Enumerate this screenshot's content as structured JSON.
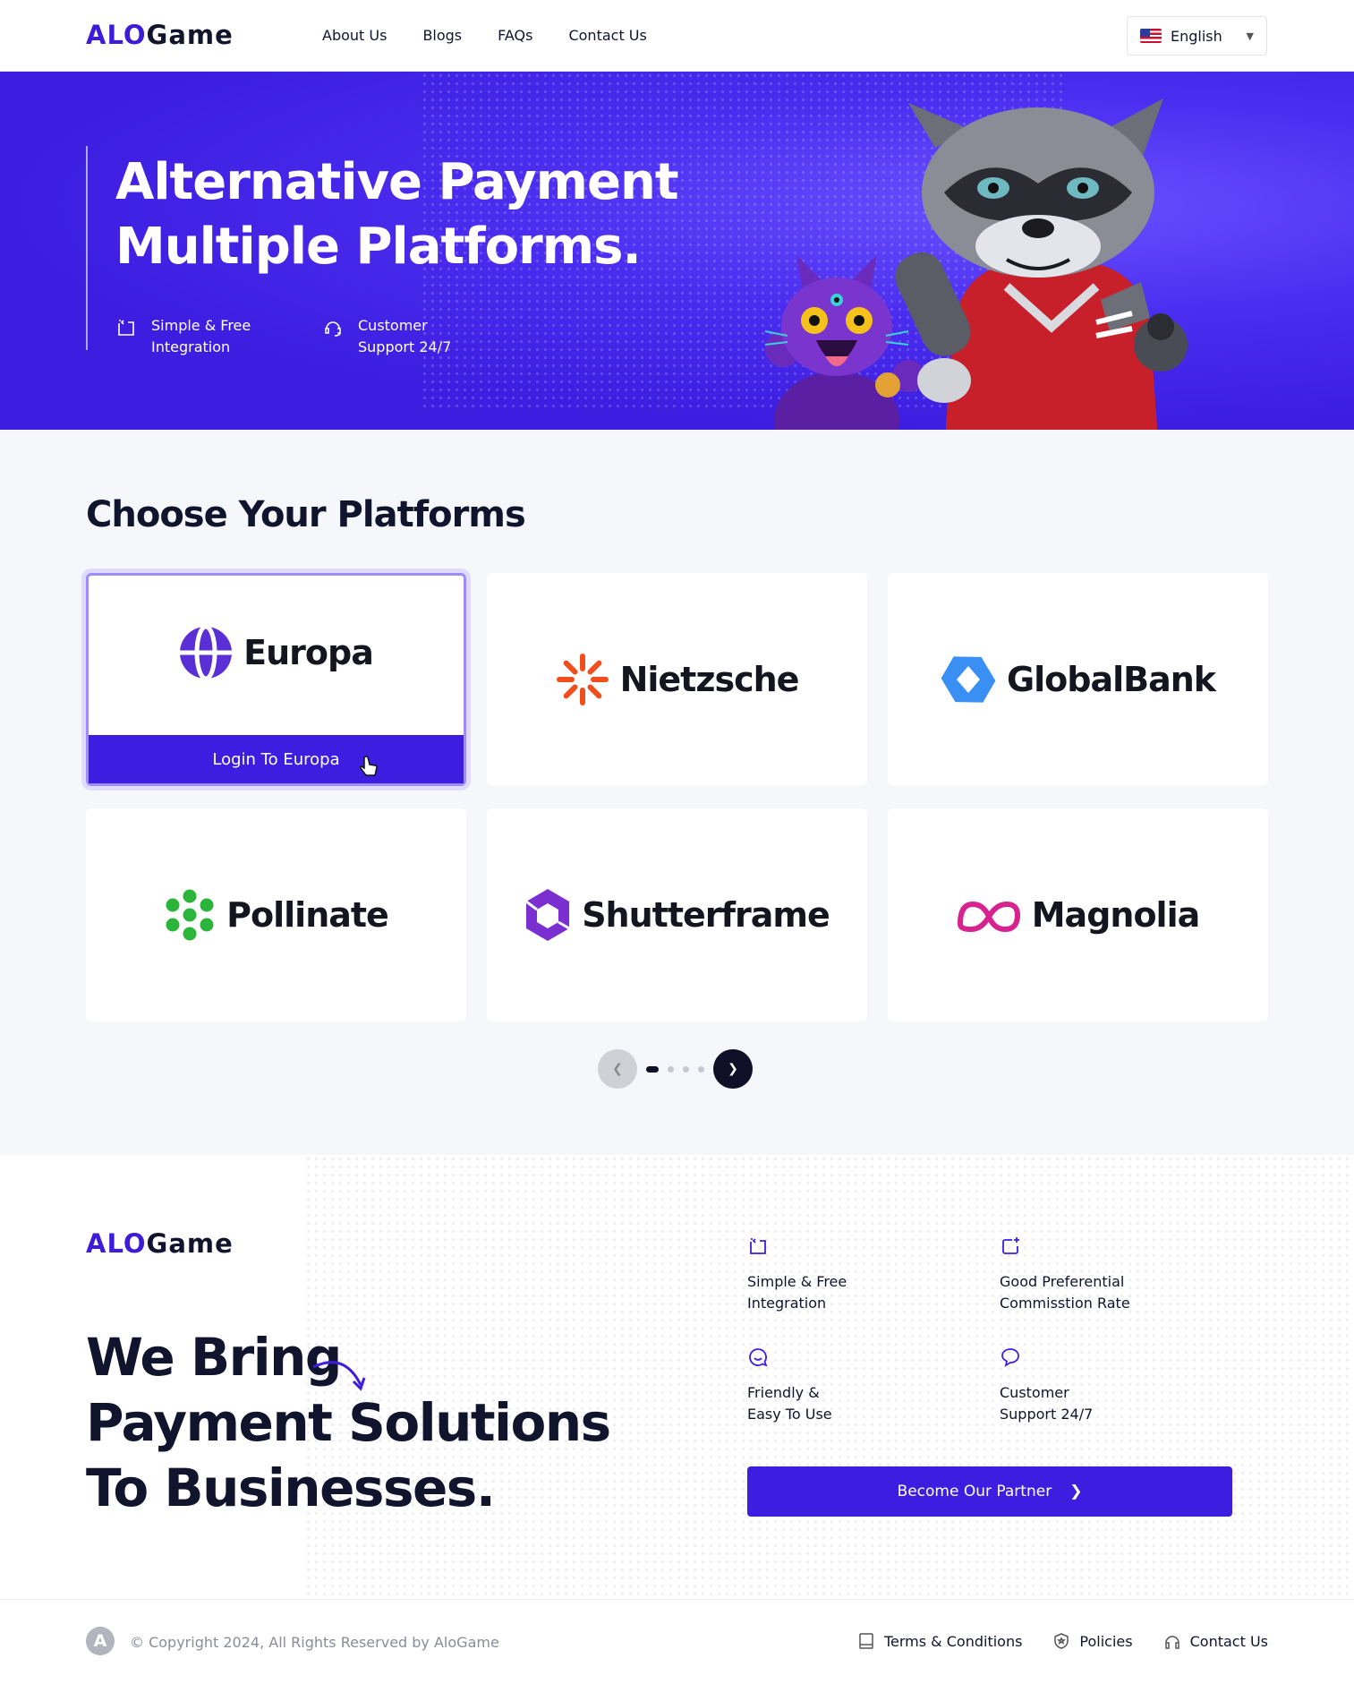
{
  "header": {
    "logo": {
      "part1": "ALO",
      "part2": "Game"
    },
    "nav": [
      "About Us",
      "Blogs",
      "FAQs",
      "Contact Us"
    ],
    "language": "English"
  },
  "hero": {
    "title_line1": "Alternative Payment",
    "title_line2": "Multiple Platforms.",
    "features": [
      {
        "line1": "Simple & Free",
        "line2": "Integration",
        "icon": "integration-icon"
      },
      {
        "line1": "Customer",
        "line2": "Support 24/7",
        "icon": "headset-icon"
      }
    ]
  },
  "platforms": {
    "title": "Choose Your Platforms",
    "items": [
      {
        "name": "Europa",
        "login_label": "Login To Europa",
        "color": "#5b2fd6"
      },
      {
        "name": "Nietzsche",
        "color": "#f04e1c"
      },
      {
        "name": "GlobalBank",
        "color": "#3a8ff5"
      },
      {
        "name": "Pollinate",
        "color": "#2bb53a"
      },
      {
        "name": "Shutterframe",
        "color": "#7b2fd1"
      },
      {
        "name": "Magnolia",
        "color": "#d6238f"
      }
    ],
    "pager": {
      "pages": 4,
      "active": 1
    }
  },
  "bring": {
    "logo": {
      "part1": "ALO",
      "part2": "Game"
    },
    "title_line1": "We Bring",
    "title_line2": "Payment Solutions",
    "title_line3": "To Businesses.",
    "features": [
      {
        "line1": "Simple & Free",
        "line2": "Integration",
        "icon": "integration-icon"
      },
      {
        "line1": "Good Preferential",
        "line2": "Commisstion Rate",
        "icon": "sparkle-card-icon"
      },
      {
        "line1": "Friendly &",
        "line2": "Easy To Use",
        "icon": "smile-chat-icon"
      },
      {
        "line1": "Customer",
        "line2": "Support 24/7",
        "icon": "chat-bubble-icon"
      }
    ],
    "partner_button": "Become Our Partner"
  },
  "footer": {
    "copyright": "© Copyright 2024, All Rights Reserved by AloGame",
    "links": [
      "Terms & Conditions",
      "Policies",
      "Contact Us"
    ]
  },
  "colors": {
    "primary": "#3d1ee0",
    "dark": "#11142d",
    "background": "#f6f7fa"
  }
}
